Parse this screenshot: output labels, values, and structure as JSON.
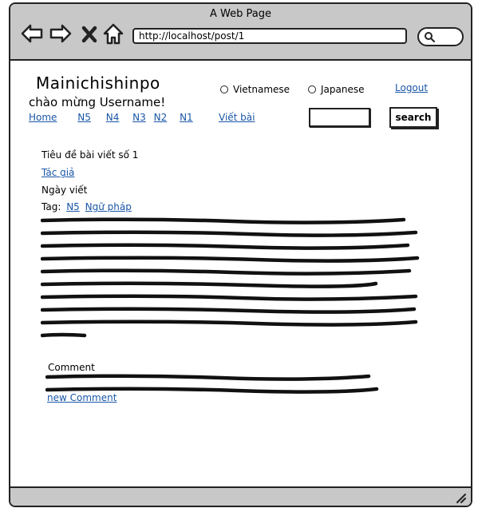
{
  "window": {
    "title": "A Web Page"
  },
  "browser": {
    "address": "http://localhost/post/1",
    "icons": [
      "back-arrow-icon",
      "forward-arrow-icon",
      "stop-icon",
      "home-icon",
      "search-icon",
      "resize-grip-icon"
    ]
  },
  "header": {
    "brand": "Mainichishinpo",
    "welcome": "chào mừng Username!",
    "nav": [
      "Home",
      "N5",
      "N4",
      "N3",
      "N2",
      "N1"
    ],
    "languages": [
      "Vietnamese",
      "Japanese"
    ],
    "logout": "Logout",
    "write_post": "Viết bài",
    "search_input_value": "",
    "search_button": "search"
  },
  "post": {
    "title": "Tiêu đề bài viết số 1",
    "author": "Tác giả",
    "date_label": "Ngày viết",
    "tags_label": "Tag:",
    "tags": [
      "N5",
      "Ngữ pháp"
    ]
  },
  "comments": {
    "label": "Comment",
    "new_comment": "new Comment"
  },
  "colors": {
    "chrome": "#c8c8c8",
    "link": "#1a56a8"
  }
}
